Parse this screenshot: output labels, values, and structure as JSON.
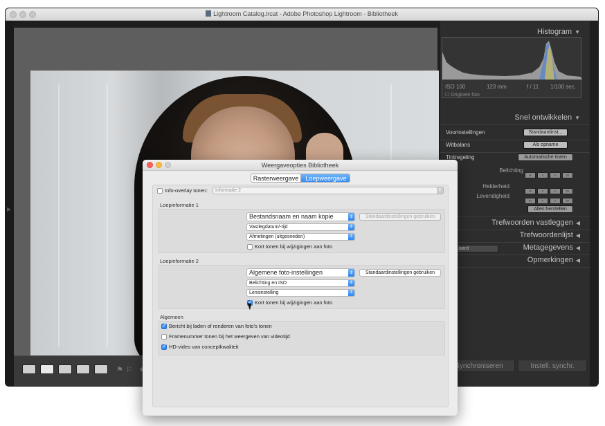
{
  "lightroom": {
    "window_title": "Lightroom Catalog.lrcat - Adobe Photoshop Lightroom - Bibliotheek",
    "right_panel": {
      "histogram_title": "Histogram",
      "histo_iso": "ISO 100",
      "histo_focal": "123 mm",
      "histo_aperture": "f / 11",
      "histo_shutter": "1/100 sec.",
      "original_photo": "Originele foto",
      "quick_develop_title": "Snel ontwikkelen",
      "presets_label": "Voorinstellingen",
      "presets_value": "Standaardinst...",
      "wb_label": "Witbalans",
      "wb_value": "Als opname",
      "tone_label": "Tintregeling",
      "auto_tone": "Automatische tinten",
      "exposure_label": "Belichting",
      "clarity_label": "Helderheid",
      "vibrance_label": "Levendigheid",
      "reset_all": "Alles herstellen",
      "keywording": "Trefwoorden vastleggen",
      "keyword_list": "Trefwoordenlijst",
      "metadata_preset": "aard",
      "metadata": "Metagegevens",
      "comments": "Opmerkingen",
      "sync": "Synchroniseren",
      "sync_settings": "Instell. synchr."
    }
  },
  "dialog": {
    "title": "Weergaveopties Bibliotheek",
    "tabs": [
      "Rasterweergave",
      "Loepweergave"
    ],
    "active_tab": "Loepweergave",
    "info_overlay_label": "Info-overlay tonen:",
    "info_overlay_value": "Informatie 2",
    "loupe1": {
      "title": "Loepinformatie 1",
      "line1": "Bestandsnaam en naam kopie",
      "line2": "Vastlegdatum/-tijd",
      "line3": "Afmetingen (uitgesneden)",
      "defaults_button": "Standaardinstellingen gebruiken",
      "show_briefly": "Kort tonen bij wijzigingen aan foto",
      "show_briefly_checked": false
    },
    "loupe2": {
      "title": "Loepinformatie 2",
      "line1": "Algemene foto-instellingen",
      "line2": "Belichting en ISO",
      "line3": "Lensinstelling",
      "defaults_button": "Standaardinstellingen gebruiken",
      "show_briefly": "Kort tonen bij wijzigingen aan foto",
      "show_briefly_checked": true
    },
    "general": {
      "title": "Algemeen",
      "opt1": "Bericht bij laden of renderen van foto's tonen",
      "opt1_checked": true,
      "opt2": "Framenummer tonen bij het weergeven van videotijd",
      "opt2_checked": false,
      "opt3": "HD-video van conceptkwaliteit",
      "opt3_checked": true
    },
    "accent_color": "#2f86f0"
  }
}
